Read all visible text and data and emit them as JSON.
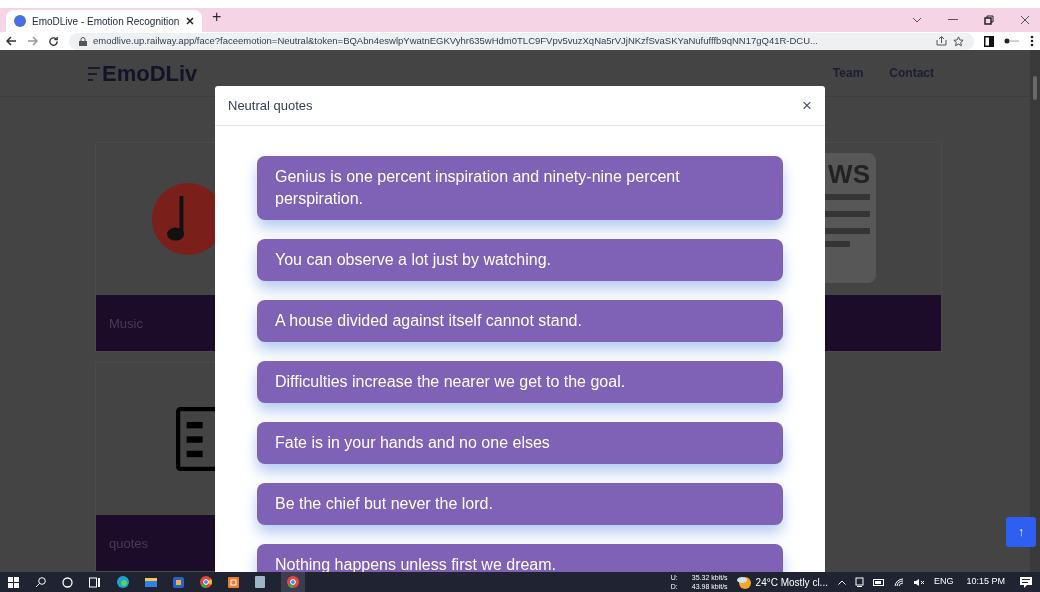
{
  "browser": {
    "tab_title": "EmoDLive - Emotion Recognition",
    "new_tab": "+",
    "url": "emodlive.up.railway.app/face?faceemotion=Neutral&token=BQAbn4eswlpYwatnEGKVyhr635wHdm0TLC9FVpv5vuzXqNa5rVJjNKzfSvaSKYaNufufffb9qNN17gQ41R-DCU..."
  },
  "site": {
    "logo": "EmoDLiv",
    "nav": [
      "Team",
      "Contact"
    ],
    "cards": [
      {
        "label": "Music",
        "kind": "music"
      },
      {
        "label": "quotes",
        "kind": "document"
      }
    ],
    "news_card": {
      "image_text": "WS"
    }
  },
  "modal": {
    "title": "Neutral quotes",
    "close": "×",
    "quotes": [
      "Genius is one percent inspiration and ninety-nine percent perspiration.",
      "You can observe a lot just by watching.",
      "A house divided against itself cannot stand.",
      "Difficulties increase the nearer we get to the goal.",
      "Fate is in your hands and no one elses",
      "Be the chief but never the lord.",
      "Nothing happens unless first we dream."
    ]
  },
  "scroll_top": "↑",
  "taskbar": {
    "net": [
      {
        "label": "U:",
        "speed": "35.32 kbit/s"
      },
      {
        "label": "D:",
        "speed": "43.98 kbit/s"
      }
    ],
    "weather": "24°C Mostly cl...",
    "language": "ENG",
    "time": "10:15 PM"
  }
}
